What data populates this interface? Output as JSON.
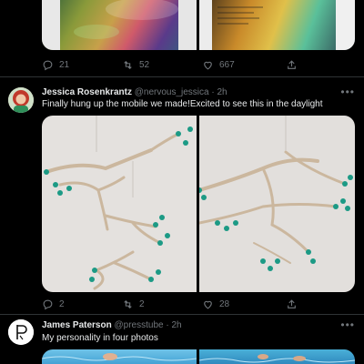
{
  "tweet_top": {
    "replies": "21",
    "retweets": "52",
    "likes": "667"
  },
  "tweet_jessica": {
    "name": "Jessica Rosenkrantz",
    "handle": "@nervous_jessica",
    "separator": "·",
    "time": "2h",
    "more": "•••",
    "text": "Finally hung up the mobile we made!Excited to see this in the daylight",
    "replies": "2",
    "retweets": "2",
    "likes": "28"
  },
  "tweet_james": {
    "name": "James Paterson",
    "handle": "@presstube",
    "separator": "·",
    "time": "2h",
    "more": "•••",
    "text": "My personality in four photos"
  },
  "icons": [
    "reply-icon",
    "retweet-icon",
    "like-icon",
    "share-icon",
    "more-icon"
  ],
  "colors": {
    "background": "#000000",
    "muted": "#71767b",
    "text": "#e7e9ea",
    "divider": "#2f3336",
    "accent_teal": "#1c9a85"
  }
}
